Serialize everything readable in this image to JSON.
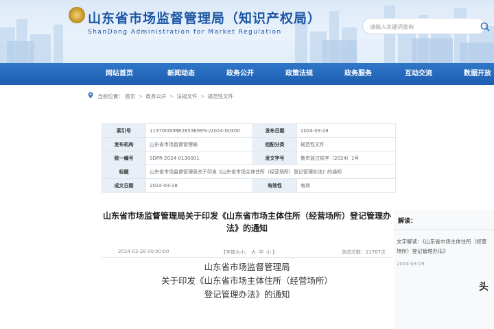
{
  "header": {
    "title": "山东省市场监督管理局（知识产权局）",
    "subtitle": "ShanDong Administration for Market Regulation",
    "search": {
      "placeholder": "请输入关键词查询"
    }
  },
  "nav": {
    "items": [
      {
        "label": "网站首页"
      },
      {
        "label": "新闻动态"
      },
      {
        "label": "政务公开"
      },
      {
        "label": "政策法规"
      },
      {
        "label": "政务服务"
      },
      {
        "label": "互动交流"
      },
      {
        "label": "数据开放"
      }
    ]
  },
  "breadcrumb": {
    "label": "当前位置：",
    "parts": [
      "首页",
      "政务公开",
      "法规文件",
      "规范性文件"
    ],
    "separator": ">"
  },
  "info": {
    "rows": [
      {
        "l1": "索引号",
        "v1": "11370000MB2853699%-/2024-00300",
        "l2": "发布日期",
        "v2": "2024-03-28"
      },
      {
        "l1": "发布机构",
        "v1": "山东省市场监督管理局",
        "l2": "组配分类",
        "v2": "规范性文件"
      },
      {
        "l1": "统一编号",
        "v1": "SDPR-2024-0130001",
        "l2": "发文字号",
        "v2": "鲁市监注规字〔2024〕1号"
      },
      {
        "l1": "标题",
        "v1": "山东省市场监督管理局关于印发《山东省市场主体住所（经营场所）登记管理办法》的通知",
        "l2": "",
        "v2": ""
      },
      {
        "l1": "成文日期",
        "v1": "2024-03-28",
        "l2": "有效性",
        "v2": "有效"
      }
    ]
  },
  "article": {
    "title": "山东省市场监督管理局关于印发《山东省市场主体住所（经营场所）登记管理办法》的通知",
    "date": "2024-03-28 00:00:00",
    "font_size_label": "【字体大小：",
    "font_sizes": [
      "大",
      "中",
      "小"
    ],
    "font_size_end": "】",
    "views": "浏览次数：11767次",
    "body_lines": [
      "山东省市场监督管理局",
      "关于印发《山东省市场主体住所（经营场所）",
      "登记管理办法》的通知"
    ]
  },
  "sidebar": {
    "title": "解读：",
    "item": "文字解读：《山东省市场主体住所（经营场所）登记管理办法》",
    "date": "2024-03-28",
    "cut_text": "头"
  }
}
